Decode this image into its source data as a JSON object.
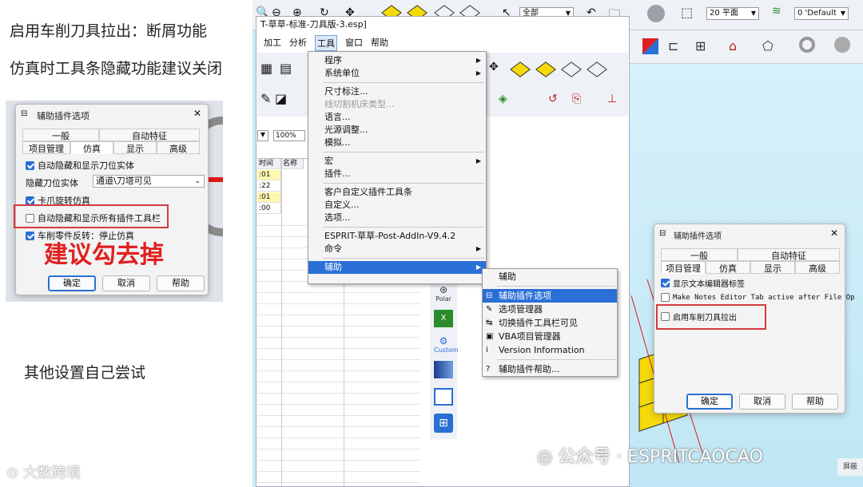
{
  "notes": {
    "line1": "启用车削刀具拉出：断屑功能",
    "line2": "仿真时工具条隐藏功能建议关闭",
    "line3": "其他设置自己尝试",
    "advice": "建议勾去掉"
  },
  "left_dialog": {
    "title": "辅助插件选项",
    "close": "✕",
    "tabs_row1": [
      "一般",
      "自动特征"
    ],
    "tabs_row2": [
      "项目管理",
      "仿真",
      "显示",
      "高级"
    ],
    "active_tab": "仿真",
    "options": [
      {
        "label": "自动隐藏和显示刀位实体",
        "checked": true
      },
      {
        "label": "卡爪旋转仿真",
        "checked": true
      },
      {
        "label": "自动隐藏和显示所有插件工具栏",
        "checked": false
      },
      {
        "label": "车削零件反转：停止仿真",
        "checked": true
      }
    ],
    "select_label": "隐藏刀位实体",
    "select_value": "通道\\刀塔可见",
    "buttons": [
      "确定",
      "取消",
      "帮助"
    ]
  },
  "app": {
    "title": "T-草草-标准-刀具版-3.esp]",
    "menubar": [
      "加工",
      "分析",
      "工具",
      "窗口",
      "帮助"
    ],
    "toolbar_combo_all": "全部",
    "toolbar_combo_plane": "20 平面",
    "toolbar_combo_layer": "0 'Default",
    "zoom": "100%",
    "grid_headers": [
      "时间",
      "名称"
    ],
    "grid_rows": [
      ":01",
      ":22",
      ":01",
      ":00"
    ],
    "side_icons": [
      "Polar",
      "Custom"
    ]
  },
  "tools_menu": {
    "items": [
      {
        "label": "程序",
        "sub": true
      },
      {
        "label": "系统单位",
        "sub": true
      },
      {
        "sep": true
      },
      {
        "label": "尺寸标注..."
      },
      {
        "label": "线切割机床类型...",
        "disabled": true
      },
      {
        "label": "语言..."
      },
      {
        "label": "光源调整..."
      },
      {
        "label": "模拟..."
      },
      {
        "sep": true
      },
      {
        "label": "宏",
        "sub": true
      },
      {
        "label": "插件..."
      },
      {
        "sep": true
      },
      {
        "label": "客户自定义插件工具条"
      },
      {
        "label": "自定义..."
      },
      {
        "label": "选项..."
      },
      {
        "sep": true
      },
      {
        "label": "ESPRIT-草草-Post-AddIn-V9.4.2"
      },
      {
        "label": "命令",
        "sub": true
      },
      {
        "sep": true
      },
      {
        "label": "辅助",
        "sub": true,
        "selected": true
      }
    ]
  },
  "sub_menu": {
    "header": "辅助",
    "items": [
      {
        "label": "辅助插件选项",
        "selected": true
      },
      {
        "label": "选项管理器"
      },
      {
        "label": "切换插件工具栏可见"
      },
      {
        "label": "VBA项目管理器"
      },
      {
        "label": "Version Information"
      },
      {
        "label": "辅助插件帮助..."
      }
    ]
  },
  "right_dialog": {
    "title": "辅助插件选项",
    "close": "✕",
    "tabs_row1": [
      "一般",
      "自动特征"
    ],
    "tabs_row2": [
      "项目管理",
      "仿真",
      "显示",
      "高级"
    ],
    "active_tab": "项目管理",
    "options": [
      {
        "label": "显示文本编辑器标签",
        "checked": true
      },
      {
        "label": "Make Notes Editor Tab active after File Op",
        "checked": false
      },
      {
        "label": "启用车削刀具拉出",
        "checked": false
      }
    ],
    "buttons": [
      "确定",
      "取消",
      "帮助"
    ]
  },
  "watermarks": {
    "left": "大数跨境",
    "right": "公众号 · ESPRITCAOCAO",
    "corner": "屏蔽"
  },
  "colors": {
    "accent": "#2a6fd6",
    "highlight": "#d63a3a",
    "cube_yellow": "#f5d90a"
  }
}
